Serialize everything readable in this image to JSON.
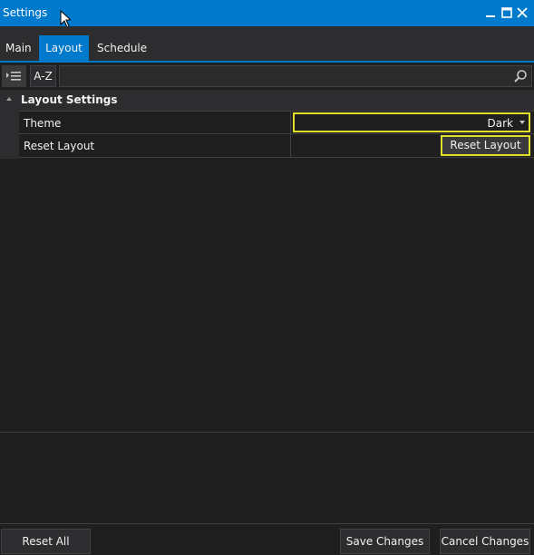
{
  "window": {
    "title": "Settings"
  },
  "tabs": [
    {
      "label": "Main",
      "active": false
    },
    {
      "label": "Layout",
      "active": true
    },
    {
      "label": "Schedule",
      "active": false
    }
  ],
  "toolbar": {
    "sort_az_label": "A-Z",
    "search_value": ""
  },
  "grid": {
    "category": "Layout Settings",
    "properties": [
      {
        "name": "Theme",
        "value": "Dark"
      },
      {
        "name": "Reset Layout",
        "button_label": "Reset Layout"
      }
    ]
  },
  "footer": {
    "reset_all": "Reset All",
    "save": "Save Changes",
    "cancel": "Cancel Changes"
  },
  "colors": {
    "accent": "#007acc",
    "highlight": "#e0e02a",
    "background": "#1f1f1f"
  }
}
